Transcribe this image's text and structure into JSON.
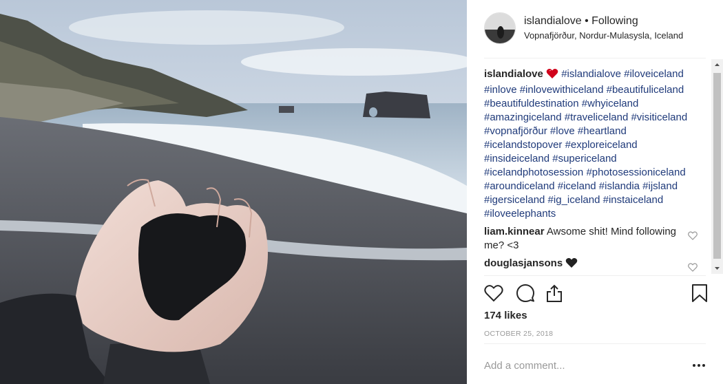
{
  "post": {
    "username": "islandialove",
    "separator": "•",
    "follow_label": "Following",
    "location": "Vopnafjörður, Nordur-Mulasysla, Iceland",
    "caption_author": "islandialove",
    "caption_tags": "#islandialove #iloveiceland #inlove #inlovewithiceland #beautifuliceland #beautifuldestination #whyiceland #amazingiceland #traveliceland #visiticeland #vopnafjörður #love #heartland #icelandstopover #exploreiceland #insideiceland #supericeland #icelandphotosession #photosessioniceland #aroundiceland #iceland #islandia #ijsland #igersiceland #ig_iceland #instaiceland #iloveelephants",
    "comments": [
      {
        "author": "liam.kinnear",
        "text": "Awsome shit! Mind following me? <3"
      },
      {
        "author": "douglasjansons",
        "text": ""
      }
    ],
    "likes": "174 likes",
    "date": "OCTOBER 25, 2018",
    "comment_placeholder": "Add a comment..."
  },
  "icons": {
    "like": "heart-outline-icon",
    "comment": "speech-bubble-icon",
    "share": "share-upload-icon",
    "save": "bookmark-icon",
    "comment_like": "small-heart-icon",
    "caption_emoji": "red-heart-icon",
    "comment_emoji": "black-heart-icon",
    "more": "ellipsis-icon"
  },
  "colors": {
    "hashtag": "#1f3a7a",
    "text": "#262626",
    "muted": "#999999",
    "heart_red": "#d0021b"
  }
}
